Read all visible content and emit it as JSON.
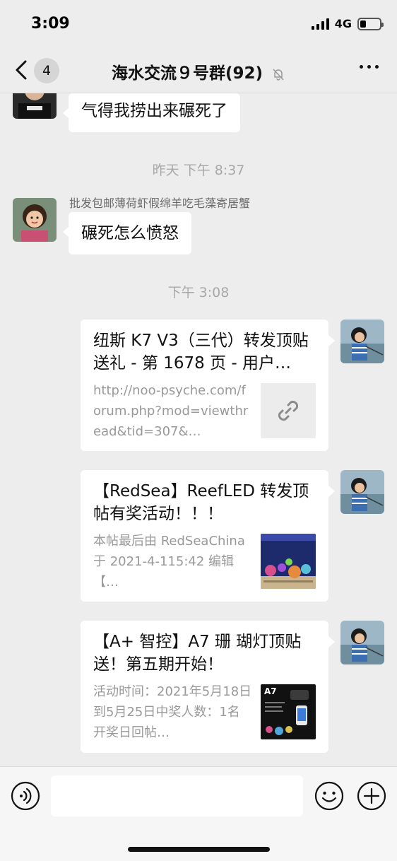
{
  "status_bar": {
    "time": "3:09",
    "network": "4G"
  },
  "nav": {
    "unread_count": "4",
    "title": "海水交流９号群(92)"
  },
  "messages": {
    "m1": {
      "text": "气得我捞出来碾死了"
    },
    "ts1": "昨天 下午 8:37",
    "m2": {
      "sender": "批发包邮薄荷虾假绵羊吃毛藻寄居蟹",
      "text": "碾死怎么愤怒"
    },
    "ts2": "下午 3:08",
    "cards": [
      {
        "title": "纽斯 K7 V3（三代）转发顶贴送礼 - 第 1678 页 - 用户…",
        "desc": "http://noo-psyche.com/forum.php?mod=viewthread&tid=307&…",
        "thumb_icon": "link-icon"
      },
      {
        "title": "【RedSea】ReefLED 转发顶帖有奖活动！！！",
        "desc": "本帖最后由 RedSeaChina 于 2021-4-115:42 编辑【…",
        "thumb_icon": "aquarium-photo"
      },
      {
        "title": "【A+ 智控】A7 珊 瑚灯顶贴送！第五期开始！",
        "desc": "活动时间：2021年5月18日到5月25日中奖人数：1名开奖日回帖…",
        "thumb_icon": "a7-product-photo",
        "thumb_label": "A7"
      }
    ]
  },
  "input": {
    "placeholder": ""
  },
  "colors": {
    "background": "#ededed",
    "bubble": "#ffffff",
    "muted_text": "#a8a8a8"
  }
}
